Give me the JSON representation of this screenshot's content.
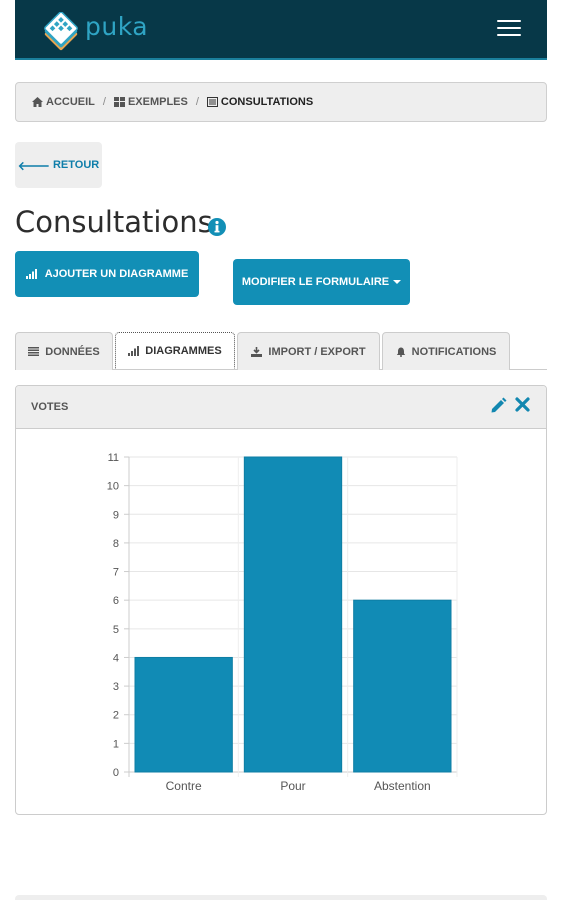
{
  "navbar": {
    "brand": "puka",
    "logo_icon": "puka-logo-icon",
    "menu_icon": "hamburger-icon",
    "brand_color": "#2fa4c4",
    "bar_color": "#073848"
  },
  "breadcrumb": {
    "items": [
      {
        "label": "ACCUEIL",
        "icon": "home-icon"
      },
      {
        "label": "EXEMPLES",
        "icon": "grid-icon"
      },
      {
        "label": "CONSULTATIONS",
        "icon": "list-icon"
      }
    ],
    "separator": "/"
  },
  "back_button": {
    "label": "RETOUR",
    "icon": "arrow-left-icon"
  },
  "page": {
    "title": "Consultations",
    "info_icon": "info-circle-icon"
  },
  "actions": {
    "add_chart": {
      "label": "AJOUTER UN DIAGRAMME",
      "icon": "bar-chart-icon"
    },
    "modify_form": {
      "label": "MODIFIER LE FORMULAIRE",
      "icon": "caret-down-icon"
    },
    "accent_color": "#128fb6"
  },
  "tabs": [
    {
      "label": "DONNÉES",
      "icon": "list-icon"
    },
    {
      "label": "DIAGRAMMES",
      "icon": "bar-chart-icon",
      "active": true
    },
    {
      "label": "IMPORT / EXPORT",
      "icon": "import-export-icon"
    },
    {
      "label": "NOTIFICATIONS",
      "icon": "bell-icon"
    }
  ],
  "panel": {
    "title": "VOTES",
    "edit_icon": "pencil-icon",
    "delete_icon": "close-icon"
  },
  "chart_data": {
    "type": "bar",
    "categories": [
      "Contre",
      "Pour",
      "Abstention"
    ],
    "values": [
      4,
      11,
      6
    ],
    "ylim": [
      0,
      11
    ],
    "yticks": [
      0,
      1,
      2,
      3,
      4,
      5,
      6,
      7,
      8,
      9,
      10,
      11
    ],
    "grid": true,
    "bar_color": "#118bb5",
    "title": "",
    "xlabel": "",
    "ylabel": ""
  }
}
